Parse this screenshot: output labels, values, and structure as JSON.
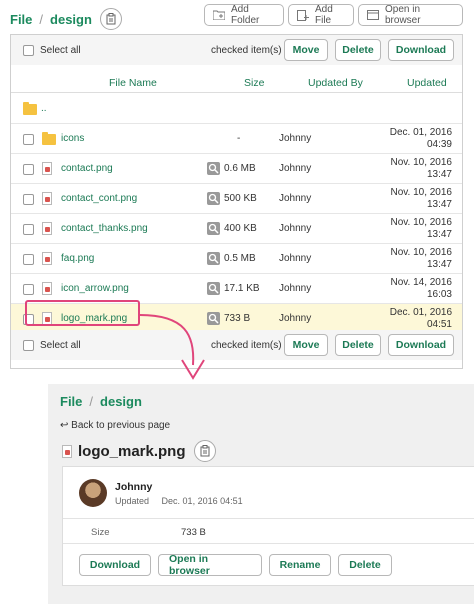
{
  "breadcrumb": {
    "root": "File",
    "sep": "/",
    "current": "design"
  },
  "toolbar": {
    "add_folder": "Add Folder",
    "add_file": "Add File",
    "open_browser": "Open in browser"
  },
  "list": {
    "select_all": "Select all",
    "checked_items": "checked item(s)",
    "move": "Move",
    "delete": "Delete",
    "download": "Download",
    "headers": {
      "name": "File Name",
      "size": "Size",
      "updated_by": "Updated By",
      "updated": "Updated"
    },
    "parent": "..",
    "rows": [
      {
        "type": "folder",
        "name": "icons",
        "size": "-",
        "by": "Johnny",
        "date1": "Dec. 01, 2016",
        "date2": "04:39"
      },
      {
        "type": "file",
        "name": "contact.png",
        "size": "0.6 MB",
        "by": "Johnny",
        "date1": "Nov. 10, 2016",
        "date2": "13:47"
      },
      {
        "type": "file",
        "name": "contact_cont.png",
        "size": "500 KB",
        "by": "Johnny",
        "date1": "Nov. 10, 2016",
        "date2": "13:47"
      },
      {
        "type": "file",
        "name": "contact_thanks.png",
        "size": "400 KB",
        "by": "Johnny",
        "date1": "Nov. 10, 2016",
        "date2": "13:47"
      },
      {
        "type": "file",
        "name": "faq.png",
        "size": "0.5 MB",
        "by": "Johnny",
        "date1": "Nov. 10, 2016",
        "date2": "13:47"
      },
      {
        "type": "file",
        "name": "icon_arrow.png",
        "size": "17.1 KB",
        "by": "Johnny",
        "date1": "Nov. 14, 2016",
        "date2": "16:03"
      },
      {
        "type": "file",
        "name": "logo_mark.png",
        "size": "733 B",
        "by": "Johnny",
        "date1": "Dec. 01, 2016",
        "date2": "04:51"
      }
    ]
  },
  "detail": {
    "breadcrumb_root": "File",
    "breadcrumb_current": "design",
    "back": "Back to previous page",
    "title": "logo_mark.png",
    "user": "Johnny",
    "updated_label": "Updated",
    "updated_value": "Dec. 01, 2016 04:51",
    "size_label": "Size",
    "size_value": "733 B",
    "download": "Download",
    "open_browser": "Open in browser",
    "rename": "Rename",
    "delete": "Delete"
  },
  "colors": {
    "accent": "#1c8a5e",
    "highlight": "#e0457b",
    "row_highlight": "#fdf8d8",
    "folder": "#f5c240"
  },
  "icons": [
    "clipboard-icon",
    "add-folder-icon",
    "add-file-icon",
    "open-browser-icon",
    "folder-icon",
    "file-icon",
    "zoom-icon",
    "back-arrow-icon",
    "curved-arrow-icon"
  ]
}
